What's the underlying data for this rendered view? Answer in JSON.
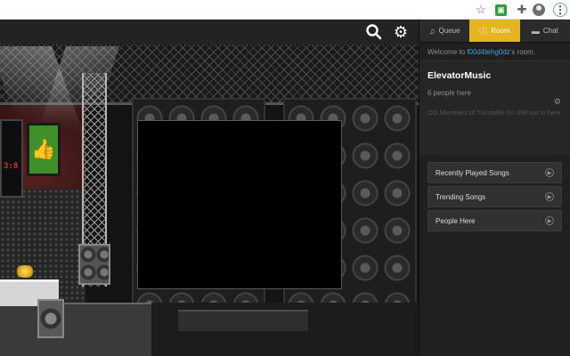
{
  "browser": {
    "star_icon": "star-icon",
    "extension_icon": "extension-icon",
    "puzzle_icon": "puzzle-icon",
    "profile_icon": "profile-avatar-icon",
    "menu_icon": "kebab-menu-icon"
  },
  "stage": {
    "search_icon": "search-icon",
    "settings_icon": "gear-icon",
    "score_text": "3:8"
  },
  "tabs": [
    {
      "label": "Queue",
      "icon": "music-note-icon",
      "active": false
    },
    {
      "label": "Room",
      "icon": "info-icon",
      "active": true
    },
    {
      "label": "Chat",
      "icon": "chat-bubble-icon",
      "active": false
    }
  ],
  "welcome": {
    "prefix": "Welcome to ",
    "username": "f00d4tehg0dz",
    "suffix": "'s room."
  },
  "room": {
    "name": "ElevatorMusic",
    "people_count": "6 people here",
    "description": "OG Members of Turntable.fm chill out in here"
  },
  "menu": [
    {
      "label": "Recently Played Songs"
    },
    {
      "label": "Trending Songs"
    },
    {
      "label": "People Here"
    }
  ],
  "colors": {
    "accent": "#e6b321",
    "link": "#3fa1d6",
    "like_panel": "#3f8f2a"
  }
}
